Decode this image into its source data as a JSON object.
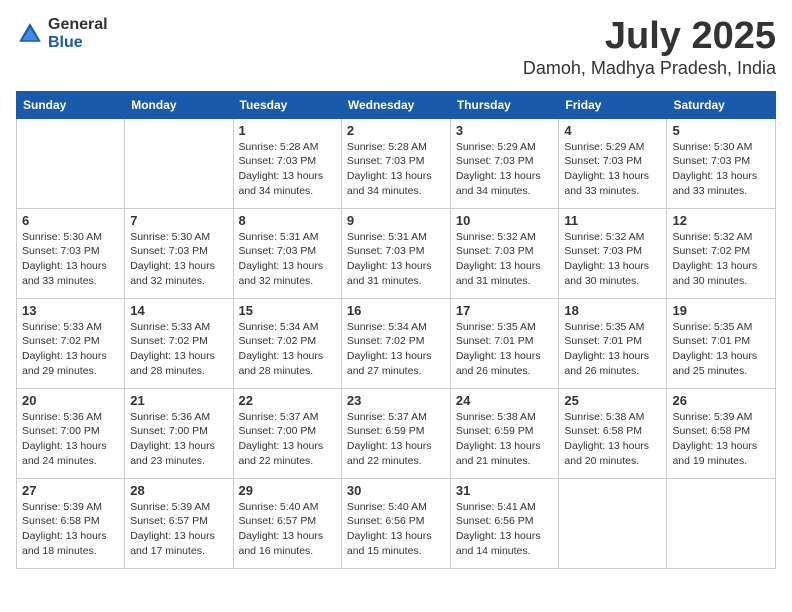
{
  "logo": {
    "general": "General",
    "blue": "Blue"
  },
  "header": {
    "month": "July 2025",
    "location": "Damoh, Madhya Pradesh, India"
  },
  "days_of_week": [
    "Sunday",
    "Monday",
    "Tuesday",
    "Wednesday",
    "Thursday",
    "Friday",
    "Saturday"
  ],
  "weeks": [
    [
      {
        "day": "",
        "empty": true
      },
      {
        "day": "",
        "empty": true
      },
      {
        "day": "1",
        "sunrise": "5:28 AM",
        "sunset": "7:03 PM",
        "daylight": "13 hours and 34 minutes."
      },
      {
        "day": "2",
        "sunrise": "5:28 AM",
        "sunset": "7:03 PM",
        "daylight": "13 hours and 34 minutes."
      },
      {
        "day": "3",
        "sunrise": "5:29 AM",
        "sunset": "7:03 PM",
        "daylight": "13 hours and 34 minutes."
      },
      {
        "day": "4",
        "sunrise": "5:29 AM",
        "sunset": "7:03 PM",
        "daylight": "13 hours and 33 minutes."
      },
      {
        "day": "5",
        "sunrise": "5:30 AM",
        "sunset": "7:03 PM",
        "daylight": "13 hours and 33 minutes."
      }
    ],
    [
      {
        "day": "6",
        "sunrise": "5:30 AM",
        "sunset": "7:03 PM",
        "daylight": "13 hours and 33 minutes."
      },
      {
        "day": "7",
        "sunrise": "5:30 AM",
        "sunset": "7:03 PM",
        "daylight": "13 hours and 32 minutes."
      },
      {
        "day": "8",
        "sunrise": "5:31 AM",
        "sunset": "7:03 PM",
        "daylight": "13 hours and 32 minutes."
      },
      {
        "day": "9",
        "sunrise": "5:31 AM",
        "sunset": "7:03 PM",
        "daylight": "13 hours and 31 minutes."
      },
      {
        "day": "10",
        "sunrise": "5:32 AM",
        "sunset": "7:03 PM",
        "daylight": "13 hours and 31 minutes."
      },
      {
        "day": "11",
        "sunrise": "5:32 AM",
        "sunset": "7:03 PM",
        "daylight": "13 hours and 30 minutes."
      },
      {
        "day": "12",
        "sunrise": "5:32 AM",
        "sunset": "7:02 PM",
        "daylight": "13 hours and 30 minutes."
      }
    ],
    [
      {
        "day": "13",
        "sunrise": "5:33 AM",
        "sunset": "7:02 PM",
        "daylight": "13 hours and 29 minutes."
      },
      {
        "day": "14",
        "sunrise": "5:33 AM",
        "sunset": "7:02 PM",
        "daylight": "13 hours and 28 minutes."
      },
      {
        "day": "15",
        "sunrise": "5:34 AM",
        "sunset": "7:02 PM",
        "daylight": "13 hours and 28 minutes."
      },
      {
        "day": "16",
        "sunrise": "5:34 AM",
        "sunset": "7:02 PM",
        "daylight": "13 hours and 27 minutes."
      },
      {
        "day": "17",
        "sunrise": "5:35 AM",
        "sunset": "7:01 PM",
        "daylight": "13 hours and 26 minutes."
      },
      {
        "day": "18",
        "sunrise": "5:35 AM",
        "sunset": "7:01 PM",
        "daylight": "13 hours and 26 minutes."
      },
      {
        "day": "19",
        "sunrise": "5:35 AM",
        "sunset": "7:01 PM",
        "daylight": "13 hours and 25 minutes."
      }
    ],
    [
      {
        "day": "20",
        "sunrise": "5:36 AM",
        "sunset": "7:00 PM",
        "daylight": "13 hours and 24 minutes."
      },
      {
        "day": "21",
        "sunrise": "5:36 AM",
        "sunset": "7:00 PM",
        "daylight": "13 hours and 23 minutes."
      },
      {
        "day": "22",
        "sunrise": "5:37 AM",
        "sunset": "7:00 PM",
        "daylight": "13 hours and 22 minutes."
      },
      {
        "day": "23",
        "sunrise": "5:37 AM",
        "sunset": "6:59 PM",
        "daylight": "13 hours and 22 minutes."
      },
      {
        "day": "24",
        "sunrise": "5:38 AM",
        "sunset": "6:59 PM",
        "daylight": "13 hours and 21 minutes."
      },
      {
        "day": "25",
        "sunrise": "5:38 AM",
        "sunset": "6:58 PM",
        "daylight": "13 hours and 20 minutes."
      },
      {
        "day": "26",
        "sunrise": "5:39 AM",
        "sunset": "6:58 PM",
        "daylight": "13 hours and 19 minutes."
      }
    ],
    [
      {
        "day": "27",
        "sunrise": "5:39 AM",
        "sunset": "6:58 PM",
        "daylight": "13 hours and 18 minutes."
      },
      {
        "day": "28",
        "sunrise": "5:39 AM",
        "sunset": "6:57 PM",
        "daylight": "13 hours and 17 minutes."
      },
      {
        "day": "29",
        "sunrise": "5:40 AM",
        "sunset": "6:57 PM",
        "daylight": "13 hours and 16 minutes."
      },
      {
        "day": "30",
        "sunrise": "5:40 AM",
        "sunset": "6:56 PM",
        "daylight": "13 hours and 15 minutes."
      },
      {
        "day": "31",
        "sunrise": "5:41 AM",
        "sunset": "6:56 PM",
        "daylight": "13 hours and 14 minutes."
      },
      {
        "day": "",
        "empty": true
      },
      {
        "day": "",
        "empty": true
      }
    ]
  ]
}
